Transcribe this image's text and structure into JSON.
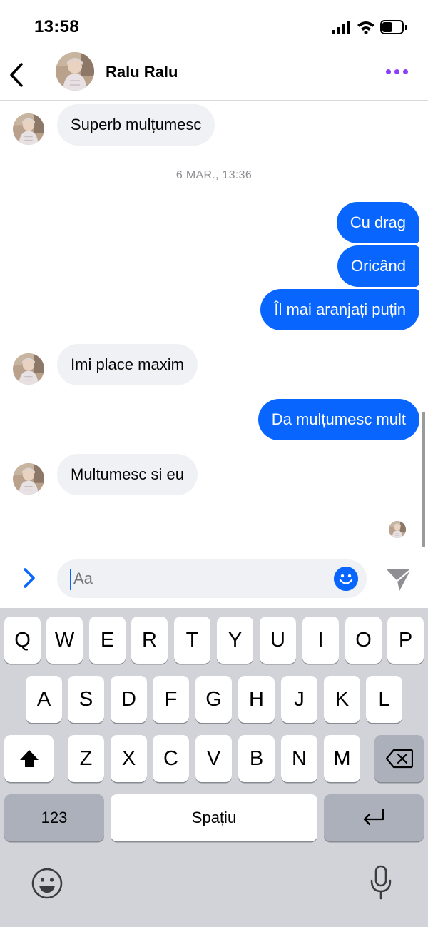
{
  "status_bar": {
    "time": "13:58"
  },
  "header": {
    "contact_name": "Ralu Ralu"
  },
  "chat": {
    "timestamp": "6 MAR., 13:36",
    "incoming": {
      "m1": "Superb mulțumesc",
      "m2": "Imi place maxim",
      "m3": "Multumesc si eu"
    },
    "outgoing": {
      "m1": "Cu drag",
      "m2": "Oricând",
      "m3": "Îl mai aranjați puțin",
      "m4": "Da mulțumesc mult"
    }
  },
  "composer": {
    "placeholder": "Aa"
  },
  "keyboard": {
    "row1": [
      "Q",
      "W",
      "E",
      "R",
      "T",
      "Y",
      "U",
      "I",
      "O",
      "P"
    ],
    "row2": [
      "A",
      "S",
      "D",
      "F",
      "G",
      "H",
      "J",
      "K",
      "L"
    ],
    "row3": [
      "Z",
      "X",
      "C",
      "V",
      "B",
      "N",
      "M"
    ],
    "numbers_label": "123",
    "space_label": "Spațiu"
  },
  "colors": {
    "accent_blue": "#0866ff",
    "more_purple": "#8a3ffc",
    "incoming_bubble": "#f0f1f4",
    "keyboard_bg": "#d1d3d9"
  },
  "icons": [
    "back-chevron-icon",
    "more-dots-icon",
    "expand-chevron-icon",
    "emoji-icon",
    "send-icon",
    "shift-icon",
    "backspace-icon",
    "return-icon",
    "keyboard-emoji-icon",
    "microphone-icon"
  ]
}
